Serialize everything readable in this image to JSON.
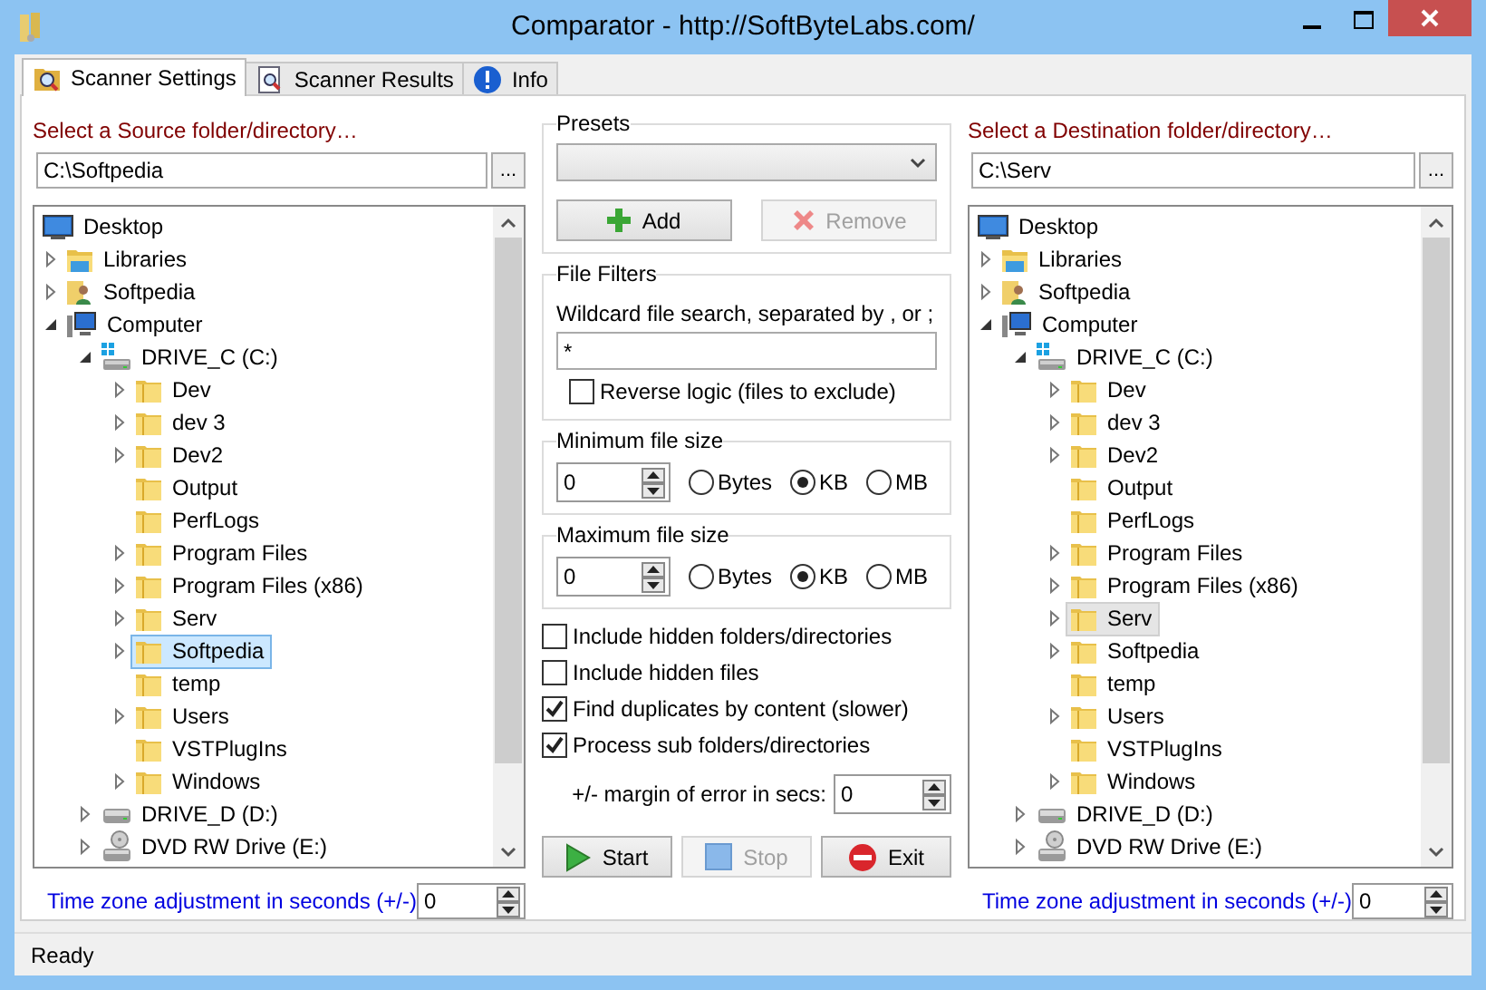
{
  "window": {
    "title": "Comparator - http://SoftByteLabs.com/"
  },
  "tabs": [
    {
      "label": "Scanner Settings",
      "selected": true
    },
    {
      "label": "Scanner Results",
      "selected": false
    },
    {
      "label": "Info",
      "selected": false
    }
  ],
  "source": {
    "label": "Select a Source folder/directory…",
    "path": "C:\\Softpedia",
    "browse": "...",
    "focused": true,
    "tree": [
      {
        "label": "Desktop",
        "kind": "desktop",
        "selected": false,
        "children": [
          {
            "label": "Libraries",
            "kind": "library",
            "expanded": false,
            "selected": false
          },
          {
            "label": "Softpedia",
            "kind": "user",
            "expanded": false,
            "selected": false
          },
          {
            "label": "Computer",
            "kind": "computer",
            "expanded": true,
            "selected": false,
            "children": [
              {
                "label": "DRIVE_C (C:)",
                "kind": "system_drive",
                "expanded": true,
                "selected": false,
                "children": [
                  {
                    "label": "Dev",
                    "kind": "folder",
                    "expanded": false,
                    "selected": false
                  },
                  {
                    "label": "dev 3",
                    "kind": "folder",
                    "expanded": false,
                    "selected": false
                  },
                  {
                    "label": "Dev2",
                    "kind": "folder",
                    "expanded": false,
                    "selected": false
                  },
                  {
                    "label": "Output",
                    "kind": "folder",
                    "selected": false
                  },
                  {
                    "label": "PerfLogs",
                    "kind": "folder",
                    "selected": false
                  },
                  {
                    "label": "Program Files",
                    "kind": "folder",
                    "expanded": false,
                    "selected": false
                  },
                  {
                    "label": "Program Files (x86)",
                    "kind": "folder",
                    "expanded": false,
                    "selected": false
                  },
                  {
                    "label": "Serv",
                    "kind": "folder",
                    "expanded": false,
                    "selected": false
                  },
                  {
                    "label": "Softpedia",
                    "kind": "folder",
                    "expanded": false,
                    "selected": true
                  },
                  {
                    "label": "temp",
                    "kind": "folder",
                    "selected": false
                  },
                  {
                    "label": "Users",
                    "kind": "folder",
                    "expanded": false,
                    "selected": false
                  },
                  {
                    "label": "VSTPlugIns",
                    "kind": "folder",
                    "selected": false
                  },
                  {
                    "label": "Windows",
                    "kind": "folder",
                    "expanded": false,
                    "selected": false
                  }
                ]
              },
              {
                "label": "DRIVE_D (D:)",
                "kind": "drive",
                "expanded": false,
                "selected": false
              },
              {
                "label": "DVD RW Drive (E:)",
                "kind": "dvd",
                "expanded": false,
                "selected": false
              }
            ]
          }
        ]
      }
    ],
    "timezone": {
      "label": "Time zone adjustment in seconds (+/-)",
      "value": "0"
    }
  },
  "presets": {
    "title": "Presets",
    "buttons": [
      {
        "label": "Add",
        "disabled": false
      },
      {
        "label": "Remove",
        "disabled": true
      }
    ]
  },
  "file_filters": {
    "title": "File Filters",
    "wildcard_label": "Wildcard file search, separated by , or ;",
    "wildcard_value": "*",
    "reverse": {
      "label": "Reverse logic (files to exclude)",
      "checked": false
    }
  },
  "min_size": {
    "title": "Minimum file size",
    "value": "0",
    "units": [
      {
        "label": "Bytes",
        "selected": false
      },
      {
        "label": "KB",
        "selected": true
      },
      {
        "label": "MB",
        "selected": false
      }
    ]
  },
  "max_size": {
    "title": "Maximum file size",
    "value": "0",
    "units": [
      {
        "label": "Bytes",
        "selected": false
      },
      {
        "label": "KB",
        "selected": true
      },
      {
        "label": "MB",
        "selected": false
      }
    ]
  },
  "options": [
    {
      "label": "Include hidden folders/directories",
      "checked": false
    },
    {
      "label": "Include hidden files",
      "checked": false
    },
    {
      "label": "Find duplicates by content (slower)",
      "checked": true
    },
    {
      "label": "Process sub folders/directories",
      "checked": true
    }
  ],
  "margin": {
    "label": "+/- margin of error in secs:",
    "value": "0"
  },
  "actions": [
    {
      "label": "Start",
      "disabled": false
    },
    {
      "label": "Stop",
      "disabled": true
    },
    {
      "label": "Exit",
      "disabled": false
    }
  ],
  "destination": {
    "label": "Select a Destination folder/directory…",
    "path": "C:\\Serv",
    "browse": "...",
    "focused": false,
    "tree": [
      {
        "label": "Desktop",
        "kind": "desktop",
        "selected": false,
        "children": [
          {
            "label": "Libraries",
            "kind": "library",
            "expanded": false,
            "selected": false
          },
          {
            "label": "Softpedia",
            "kind": "user",
            "expanded": false,
            "selected": false
          },
          {
            "label": "Computer",
            "kind": "computer",
            "expanded": true,
            "selected": false,
            "children": [
              {
                "label": "DRIVE_C (C:)",
                "kind": "system_drive",
                "expanded": true,
                "selected": false,
                "children": [
                  {
                    "label": "Dev",
                    "kind": "folder",
                    "expanded": false,
                    "selected": false
                  },
                  {
                    "label": "dev 3",
                    "kind": "folder",
                    "expanded": false,
                    "selected": false
                  },
                  {
                    "label": "Dev2",
                    "kind": "folder",
                    "expanded": false,
                    "selected": false
                  },
                  {
                    "label": "Output",
                    "kind": "folder",
                    "selected": false
                  },
                  {
                    "label": "PerfLogs",
                    "kind": "folder",
                    "selected": false
                  },
                  {
                    "label": "Program Files",
                    "kind": "folder",
                    "expanded": false,
                    "selected": false
                  },
                  {
                    "label": "Program Files (x86)",
                    "kind": "folder",
                    "expanded": false,
                    "selected": false
                  },
                  {
                    "label": "Serv",
                    "kind": "folder",
                    "expanded": false,
                    "selected": true
                  },
                  {
                    "label": "Softpedia",
                    "kind": "folder",
                    "expanded": false,
                    "selected": false
                  },
                  {
                    "label": "temp",
                    "kind": "folder",
                    "selected": false
                  },
                  {
                    "label": "Users",
                    "kind": "folder",
                    "expanded": false,
                    "selected": false
                  },
                  {
                    "label": "VSTPlugIns",
                    "kind": "folder",
                    "selected": false
                  },
                  {
                    "label": "Windows",
                    "kind": "folder",
                    "expanded": false,
                    "selected": false
                  }
                ]
              },
              {
                "label": "DRIVE_D (D:)",
                "kind": "drive",
                "expanded": false,
                "selected": false
              },
              {
                "label": "DVD RW Drive (E:)",
                "kind": "dvd",
                "expanded": false,
                "selected": false
              }
            ]
          }
        ]
      }
    ],
    "timezone": {
      "label": "Time zone adjustment in seconds (+/-)",
      "value": "0"
    }
  },
  "status_bar": {
    "text": "Ready"
  }
}
